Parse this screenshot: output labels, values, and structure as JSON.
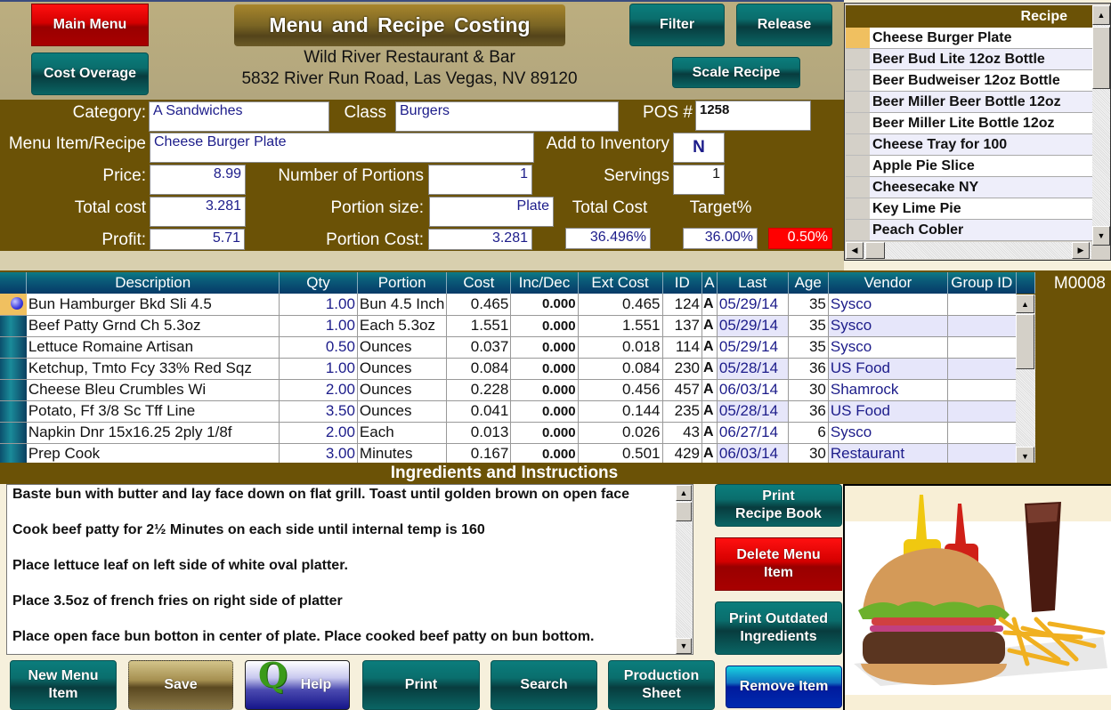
{
  "header": {
    "title": "Menu and Recipe Costing",
    "restaurant_name": "Wild River Restaurant & Bar",
    "address": "5832 River Run Road, Las Vegas, NV 89120",
    "buttons": {
      "main_menu": "Main Menu",
      "cost_overage": "Cost Overage",
      "filter": "Filter",
      "release": "Release",
      "scale_recipe": "Scale Recipe"
    }
  },
  "form": {
    "category_label": "Category:",
    "category_value": "A Sandwiches",
    "class_label": "Class",
    "class_value": "Burgers",
    "pos_label": "POS #",
    "pos_value": "1258",
    "menu_item_label": "Menu Item/Recipe",
    "menu_item_value": "Cheese Burger Plate",
    "add_inventory_label": "Add to Inventory",
    "add_inventory_value": "N",
    "price_label": "Price:",
    "price_value": "8.99",
    "num_portions_label": "Number of Portions",
    "num_portions_value": "1",
    "servings_label": "Servings",
    "servings_value": "1",
    "total_cost_label": "Total cost",
    "total_cost_value": "3.281",
    "portion_size_label": "Portion size:",
    "portion_size_value": "Plate",
    "total_cost_pct_label": "Total Cost",
    "target_pct_label": "Target%",
    "profit_label": "Profit:",
    "profit_value": "5.71",
    "portion_cost_label": "Portion Cost:",
    "portion_cost_value": "3.281",
    "total_cost_pct_value": "36.496%",
    "target_pct_value": "36.00%",
    "variance_pct_value": "0.50%",
    "variance_color": "#ff0000"
  },
  "recipe_list": {
    "header": "Recipe",
    "selected_index": 0,
    "items": [
      "Cheese Burger Plate",
      "Beer Bud Lite 12oz Bottle",
      "Beer Budweiser 12oz Bottle",
      "Beer Miller Beer Bottle 12oz",
      "Beer Miller Lite Bottle 12oz",
      "Cheese  Tray for 100",
      "Apple Pie Slice",
      "Cheesecake NY",
      "Key Lime Pie",
      "Peach Cobler"
    ]
  },
  "grid": {
    "code": "M0008",
    "columns": [
      "Description",
      "Qty",
      "Portion",
      "Cost",
      "Inc/Dec",
      "Ext Cost",
      "ID",
      "A",
      "Last",
      "Age",
      "Vendor",
      "Group ID"
    ],
    "rows": [
      {
        "desc": "Bun Hamburger Bkd Sli 4.5",
        "qty": "1.00",
        "portion": "Bun 4.5 Inch",
        "cost": "0.465",
        "incdec": "0.000",
        "ext": "0.465",
        "id": "124",
        "a": "A",
        "last": "05/29/14",
        "age": "35",
        "vendor": "Sysco",
        "group": ""
      },
      {
        "desc": "Beef Patty Grnd Ch 5.3oz",
        "qty": "1.00",
        "portion": "Each 5.3oz",
        "cost": "1.551",
        "incdec": "0.000",
        "ext": "1.551",
        "id": "137",
        "a": "A",
        "last": "05/29/14",
        "age": "35",
        "vendor": "Sysco",
        "group": ""
      },
      {
        "desc": "Lettuce Romaine Artisan",
        "qty": "0.50",
        "portion": "Ounces",
        "cost": "0.037",
        "incdec": "0.000",
        "ext": "0.018",
        "id": "114",
        "a": "A",
        "last": "05/29/14",
        "age": "35",
        "vendor": "Sysco",
        "group": ""
      },
      {
        "desc": "Ketchup, Tmto Fcy 33% Red Sqz",
        "qty": "1.00",
        "portion": "Ounces",
        "cost": "0.084",
        "incdec": "0.000",
        "ext": "0.084",
        "id": "230",
        "a": "A",
        "last": "05/28/14",
        "age": "36",
        "vendor": "US Food",
        "group": ""
      },
      {
        "desc": "Cheese Bleu Crumbles Wi",
        "qty": "2.00",
        "portion": "Ounces",
        "cost": "0.228",
        "incdec": "0.000",
        "ext": "0.456",
        "id": "457",
        "a": "A",
        "last": "06/03/14",
        "age": "30",
        "vendor": "Shamrock",
        "group": ""
      },
      {
        "desc": "Potato, Ff 3/8 Sc Tff Line",
        "qty": "3.50",
        "portion": "Ounces",
        "cost": "0.041",
        "incdec": "0.000",
        "ext": "0.144",
        "id": "235",
        "a": "A",
        "last": "05/28/14",
        "age": "36",
        "vendor": "US Food",
        "group": ""
      },
      {
        "desc": "Napkin Dnr 15x16.25 2ply 1/8f",
        "qty": "2.00",
        "portion": "Each",
        "cost": "0.013",
        "incdec": "0.000",
        "ext": "0.026",
        "id": "43",
        "a": "A",
        "last": "06/27/14",
        "age": "6",
        "vendor": "Sysco",
        "group": ""
      },
      {
        "desc": "Prep Cook",
        "qty": "3.00",
        "portion": "Minutes",
        "cost": "0.167",
        "incdec": "0.000",
        "ext": "0.501",
        "id": "429",
        "a": "A",
        "last": "06/03/14",
        "age": "30",
        "vendor": "Restaurant",
        "group": ""
      }
    ]
  },
  "instructions": {
    "title": "Ingredients and Instructions",
    "lines": [
      "Baste bun with butter and lay face down on flat grill. Toast until golden brown on open face",
      "Cook beef patty for 2½ Minutes on each side until internal temp is 160",
      "Place lettuce leaf on left side of white oval platter.",
      "Place 3.5oz of french fries on right side of platter",
      "Place open face bun botton in center of plate. Place cooked beef patty on bun bottom."
    ]
  },
  "side_buttons": {
    "print_recipe_book": "Print\nRecipe Book",
    "delete_menu_item": "Delete  Menu\nItem",
    "print_outdated": "Print Outdated\nIngredients",
    "remove_item": "Remove Item"
  },
  "bottom_buttons": {
    "new_menu_item": "New Menu\nItem",
    "save": "Save",
    "help": "Help",
    "print": "Print",
    "search": "Search",
    "production_sheet": "Production\nSheet"
  },
  "photo": {
    "subject": "cheeseburger plate with fries, ketchup, mustard and cola"
  }
}
